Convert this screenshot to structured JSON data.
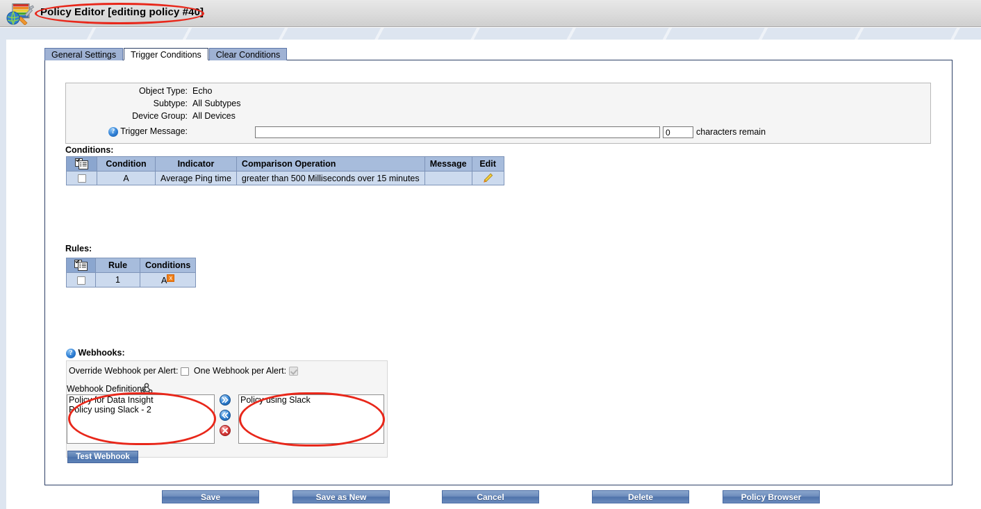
{
  "window": {
    "title": "Policy Editor [editing policy #40]",
    "app_icon": "policy-editor-icon"
  },
  "tabs": [
    {
      "label": "General Settings",
      "active": false
    },
    {
      "label": "Trigger Conditions",
      "active": true
    },
    {
      "label": "Clear Conditions",
      "active": false
    }
  ],
  "info": {
    "object_type_label": "Object Type:",
    "object_type_value": "Echo",
    "subtype_label": "Subtype:",
    "subtype_value": "All Subtypes",
    "device_group_label": "Device Group:",
    "device_group_value": "All Devices",
    "trigger_message_label": "Trigger Message:",
    "trigger_message_value": "",
    "trigger_message_placeholder": "",
    "characters_count": "0",
    "characters_remain_label": "characters remain"
  },
  "conditions": {
    "section_label": "Conditions:",
    "columns": [
      "",
      "Condition",
      "Indicator",
      "Comparison Operation",
      "Message",
      "Edit"
    ],
    "rows": [
      {
        "condition": "A",
        "indicator": "Average Ping time",
        "comparison": "greater than 500 Milliseconds over 15 minutes",
        "message": "",
        "edit_icon": "pencil-icon"
      }
    ]
  },
  "rules": {
    "section_label": "Rules:",
    "columns": [
      "",
      "Rule",
      "Conditions"
    ],
    "rows": [
      {
        "rule": "1",
        "conditions": "A",
        "delete_badge": "x"
      }
    ]
  },
  "webhooks": {
    "section_label": "Webhooks:",
    "override_label": "Override Webhook per Alert:",
    "override_checked": false,
    "one_per_alert_label": "One Webhook per Alert:",
    "one_per_alert_checked": true,
    "definitions_label": "Webhook Definitions",
    "definitions_icon": "webhook-icon",
    "available": [
      "Policy for Data Insight",
      "Policy using Slack - 2"
    ],
    "selected": [
      "Policy using Slack"
    ],
    "add_button_icon": "chevron-double-right-icon",
    "remove_button_icon": "chevron-double-left-icon",
    "delete_button_icon": "delete-circle-icon",
    "test_button_label": "Test Webhook"
  },
  "footer": {
    "buttons": [
      {
        "label": "Save"
      },
      {
        "label": "Save as New"
      },
      {
        "label": "Cancel"
      },
      {
        "label": "Delete"
      },
      {
        "label": "Policy Browser"
      }
    ]
  },
  "colors": {
    "annotation": "#e8271a",
    "tab_inactive": "#9fb2d4",
    "table_header": "#a7bcdc",
    "table_row": "#ccdaee",
    "button_blue": "#5b80b4"
  }
}
